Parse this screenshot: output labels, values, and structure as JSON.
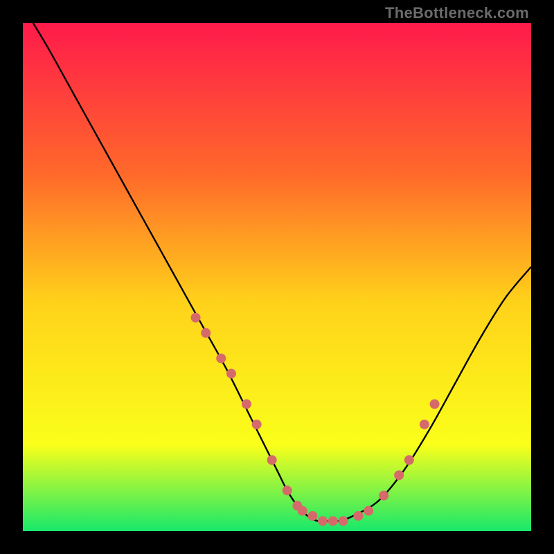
{
  "watermark": "TheBottleneck.com",
  "colors": {
    "background": "#000000",
    "gradient_top": "#ff1a4b",
    "gradient_mid_upper": "#ff6a2a",
    "gradient_mid": "#ffd21a",
    "gradient_mid_lower": "#faff1a",
    "gradient_bottom": "#17e86b",
    "curve": "#000000",
    "dots": "#d66a6a"
  },
  "chart_data": {
    "type": "line",
    "title": "",
    "xlabel": "",
    "ylabel": "",
    "xlim": [
      0,
      100
    ],
    "ylim": [
      0,
      100
    ],
    "series": [
      {
        "name": "bottleneck-curve",
        "x": [
          2,
          5,
          10,
          15,
          20,
          25,
          30,
          35,
          40,
          45,
          50,
          52,
          54,
          56,
          58,
          60,
          62,
          65,
          70,
          75,
          80,
          85,
          90,
          95,
          100
        ],
        "y": [
          100,
          95,
          86,
          77,
          68,
          59,
          50,
          41,
          32,
          22,
          12,
          8,
          5,
          3,
          2,
          2,
          2,
          3,
          6,
          12,
          20,
          29,
          38,
          46,
          52
        ]
      }
    ],
    "dots": {
      "name": "highlight-dots",
      "x": [
        34,
        36,
        39,
        41,
        44,
        46,
        49,
        52,
        54,
        55,
        57,
        59,
        61,
        63,
        66,
        68,
        71,
        74,
        76,
        79,
        81
      ],
      "y": [
        42,
        39,
        34,
        31,
        25,
        21,
        14,
        8,
        5,
        4,
        3,
        2,
        2,
        2,
        3,
        4,
        7,
        11,
        14,
        21,
        25
      ]
    }
  }
}
